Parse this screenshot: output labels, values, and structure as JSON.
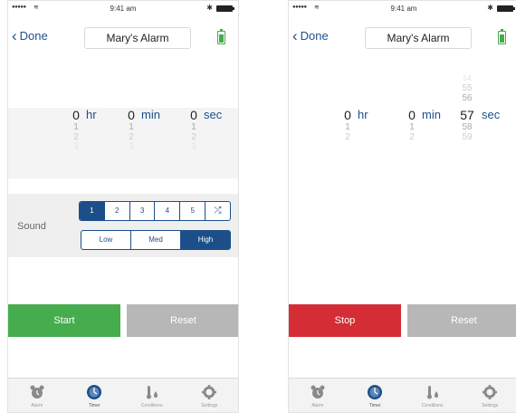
{
  "colors": {
    "accent": "#1c4f8a",
    "start": "#45ad4d",
    "stop": "#d42d35",
    "reset": "#b7b7b7",
    "battery": "#48a94a"
  },
  "left": {
    "status": {
      "time": "9:41 am"
    },
    "nav": {
      "back_label": "Done",
      "title": "Mary's Alarm"
    },
    "picker": {
      "hr": {
        "value": "0",
        "unit": "hr",
        "below": [
          "1",
          "2",
          "3"
        ]
      },
      "min": {
        "value": "0",
        "unit": "min",
        "below": [
          "1",
          "2",
          "3"
        ]
      },
      "sec": {
        "value": "0",
        "unit": "sec",
        "below": [
          "1",
          "2",
          "3"
        ]
      }
    },
    "sound": {
      "label": "Sound",
      "numbers": [
        "1",
        "2",
        "3",
        "4",
        "5"
      ],
      "selected_number": "1",
      "shuffle_icon": "shuffle-icon",
      "volumes": [
        "Low",
        "Med",
        "High"
      ],
      "selected_volume": "High"
    },
    "buttons": {
      "primary": "Start",
      "secondary": "Reset"
    }
  },
  "right": {
    "status": {
      "time": "9:41 am"
    },
    "nav": {
      "back_label": "Done",
      "title": "Mary's Alarm"
    },
    "picker": {
      "hr": {
        "value": "0",
        "unit": "hr",
        "below": [
          "1",
          "2"
        ]
      },
      "min": {
        "value": "0",
        "unit": "min",
        "below": [
          "1",
          "2"
        ]
      },
      "sec": {
        "value": "57",
        "unit": "sec",
        "above": [
          "54",
          "55",
          "56"
        ],
        "below": [
          "58",
          "59"
        ]
      }
    },
    "buttons": {
      "primary": "Stop",
      "secondary": "Reset"
    }
  },
  "tabbar": {
    "tabs": [
      {
        "label": "Alarm",
        "icon": "alarm-clock-icon"
      },
      {
        "label": "Timer",
        "icon": "timer-icon"
      },
      {
        "label": "Conditions",
        "icon": "thermometer-icon"
      },
      {
        "label": "Settings",
        "icon": "gear-icon"
      }
    ],
    "active_tab": "Timer"
  }
}
